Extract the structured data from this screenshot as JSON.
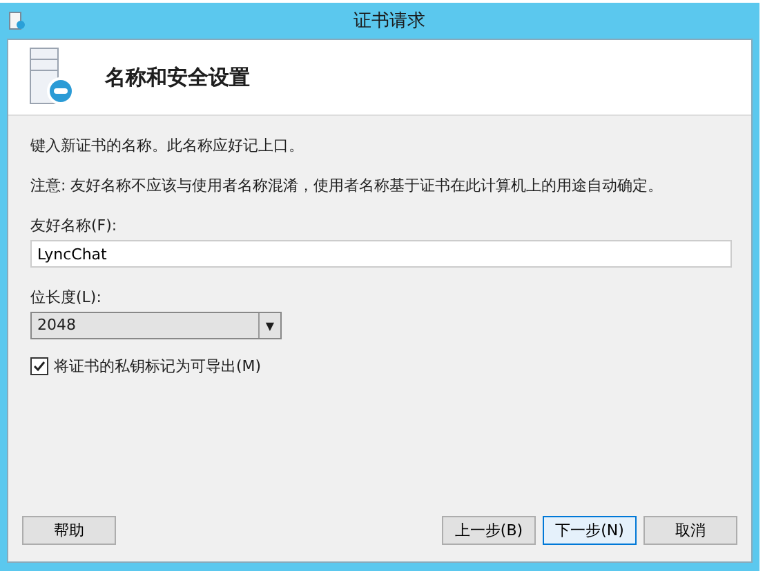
{
  "window": {
    "title": "证书请求"
  },
  "header": {
    "title": "名称和安全设置"
  },
  "intro": "键入新证书的名称。此名称应好记上口。",
  "note": "注意: 友好名称不应该与使用者名称混淆，使用者名称基于证书在此计算机上的用途自动确定。",
  "friendly_name": {
    "label": "友好名称(F):",
    "value": "LyncChat"
  },
  "bit_length": {
    "label": "位长度(L):",
    "value": "2048",
    "arrow": "▼"
  },
  "exportable": {
    "label": "将证书的私钥标记为可导出(M)",
    "checked": true
  },
  "buttons": [
    {
      "label": "帮助",
      "kind": "help",
      "selected": false
    },
    {
      "label": "上一步(B)",
      "kind": "nav",
      "selected": false
    },
    {
      "label": "下一步(N)",
      "kind": "nav",
      "selected": true
    },
    {
      "label": "取消",
      "kind": "nav",
      "selected": false
    }
  ]
}
